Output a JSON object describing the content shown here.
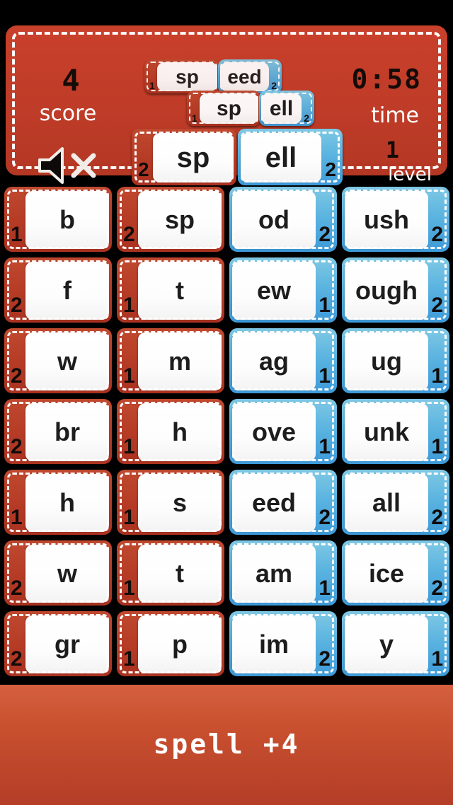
{
  "header": {
    "score": {
      "value": "4",
      "label": "score"
    },
    "time": {
      "value": "0:58",
      "label": "time"
    },
    "level": {
      "value": "1",
      "label": "level"
    },
    "mute_icon": "speaker-mute-icon",
    "word_stack": [
      {
        "id": "speed",
        "parts": [
          {
            "text": "sp",
            "badge": "1",
            "color": "red"
          },
          {
            "text": "eed",
            "badge": "2",
            "color": "blue"
          }
        ]
      },
      {
        "id": "spell-mid",
        "parts": [
          {
            "text": "sp",
            "badge": "1",
            "color": "red"
          },
          {
            "text": "ell",
            "badge": "2",
            "color": "blue"
          }
        ]
      },
      {
        "id": "spell-big",
        "parts": [
          {
            "text": "sp",
            "badge": "2",
            "color": "red"
          },
          {
            "text": "ell",
            "badge": "2",
            "color": "blue"
          }
        ]
      }
    ]
  },
  "grid": {
    "columns": 4,
    "rows": 7,
    "tiles": [
      {
        "text": "b",
        "badge": "1",
        "color": "red"
      },
      {
        "text": "sp",
        "badge": "2",
        "color": "red"
      },
      {
        "text": "od",
        "badge": "2",
        "color": "blue"
      },
      {
        "text": "ush",
        "badge": "2",
        "color": "blue"
      },
      {
        "text": "f",
        "badge": "2",
        "color": "red"
      },
      {
        "text": "t",
        "badge": "1",
        "color": "red"
      },
      {
        "text": "ew",
        "badge": "1",
        "color": "blue"
      },
      {
        "text": "ough",
        "badge": "2",
        "color": "blue"
      },
      {
        "text": "w",
        "badge": "2",
        "color": "red"
      },
      {
        "text": "m",
        "badge": "1",
        "color": "red"
      },
      {
        "text": "ag",
        "badge": "1",
        "color": "blue"
      },
      {
        "text": "ug",
        "badge": "1",
        "color": "blue"
      },
      {
        "text": "br",
        "badge": "2",
        "color": "red"
      },
      {
        "text": "h",
        "badge": "1",
        "color": "red"
      },
      {
        "text": "ove",
        "badge": "1",
        "color": "blue"
      },
      {
        "text": "unk",
        "badge": "1",
        "color": "blue"
      },
      {
        "text": "h",
        "badge": "1",
        "color": "red"
      },
      {
        "text": "s",
        "badge": "1",
        "color": "red"
      },
      {
        "text": "eed",
        "badge": "2",
        "color": "blue"
      },
      {
        "text": "all",
        "badge": "2",
        "color": "blue"
      },
      {
        "text": "w",
        "badge": "2",
        "color": "red"
      },
      {
        "text": "t",
        "badge": "1",
        "color": "red"
      },
      {
        "text": "am",
        "badge": "1",
        "color": "blue"
      },
      {
        "text": "ice",
        "badge": "2",
        "color": "blue"
      },
      {
        "text": "gr",
        "badge": "2",
        "color": "red"
      },
      {
        "text": "p",
        "badge": "1",
        "color": "red"
      },
      {
        "text": "im",
        "badge": "2",
        "color": "blue"
      },
      {
        "text": "y",
        "badge": "1",
        "color": "blue"
      }
    ]
  },
  "banner": {
    "text": "spell +4"
  },
  "colors": {
    "background": "#000000",
    "red_tile": "#b63c26",
    "blue_tile": "#5bb4e0",
    "panel_white": "#ffffff",
    "lcd_dark": "#150b08",
    "banner_top": "#d4603f",
    "banner_bottom": "#b33d27"
  }
}
